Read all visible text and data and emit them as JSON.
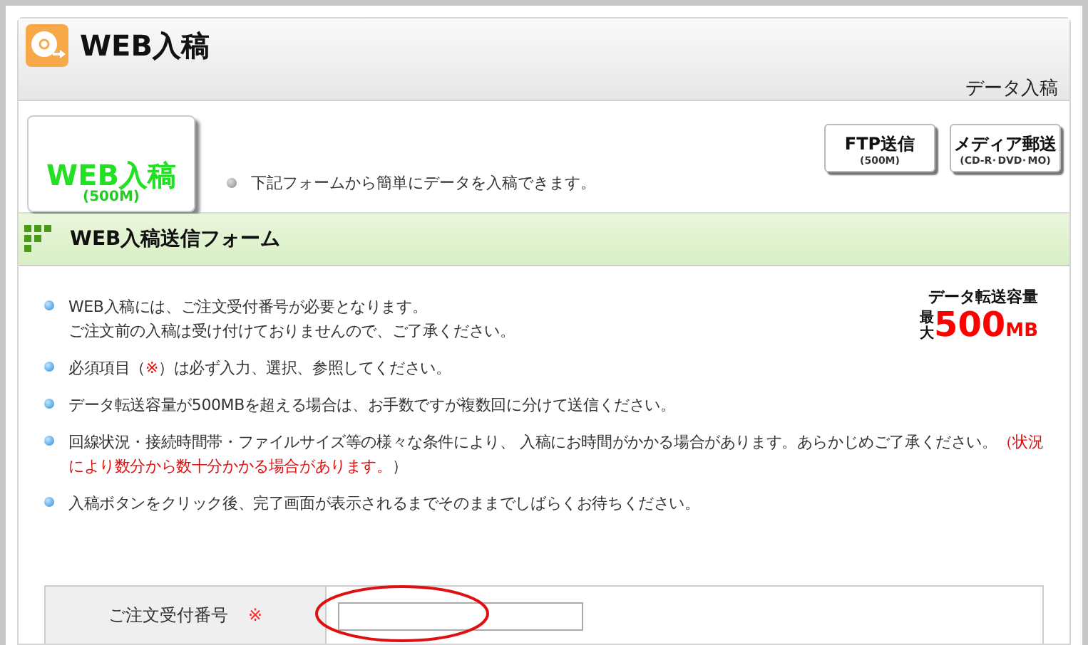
{
  "header": {
    "title": "WEB入稿",
    "breadcrumb": "データ入稿"
  },
  "banner": {
    "badge": {
      "title": "WEB入稿",
      "size": "(500M)"
    },
    "intro": "下記フォームから簡単にデータを入稿できます。",
    "services": [
      {
        "title": "FTP送信",
        "sub": "(500M)"
      },
      {
        "title": "メディア郵送",
        "sub": "(CD-R･DVD･MO)"
      }
    ]
  },
  "section": {
    "title": "WEB入稿送信フォーム"
  },
  "capacity": {
    "label": "データ転送容量",
    "prefix": "最大",
    "value": "500",
    "unit": "MB"
  },
  "notices": [
    {
      "lines": [
        [
          {
            "text": "WEB入稿には、ご注文受付番号が必要となります。",
            "red": false
          }
        ],
        [
          {
            "text": "ご注文前の入稿は受け付けておりませんので、ご了承ください。",
            "red": false
          }
        ]
      ]
    },
    {
      "lines": [
        [
          {
            "text": "必須項目（",
            "red": false
          },
          {
            "text": "※",
            "red": true
          },
          {
            "text": "）は必ず入力、選択、参照してください。",
            "red": false
          }
        ]
      ]
    },
    {
      "lines": [
        [
          {
            "text": "データ転送容量が500MBを超える場合は、お手数ですが複数回に分けて送信ください。",
            "red": false
          }
        ]
      ]
    },
    {
      "lines": [
        [
          {
            "text": "回線状況・接続時間帯・ファイルサイズ等の様々な条件により、 入稿にお時間がかかる場合があります。あらかじめご了承ください。",
            "red": false
          },
          {
            "text": "（状況により数分から数十分かかる場合があります。",
            "red": true
          },
          {
            "text": "）",
            "red": false
          }
        ]
      ]
    },
    {
      "lines": [
        [
          {
            "text": "入稿ボタンをクリック後、完了画面が表示されるまでそのままでしばらくお待ちください。",
            "red": false
          }
        ]
      ]
    }
  ],
  "form": {
    "rows": [
      {
        "label": "ご注文受付番号",
        "required_mark": "※",
        "highlighted": true
      }
    ]
  }
}
